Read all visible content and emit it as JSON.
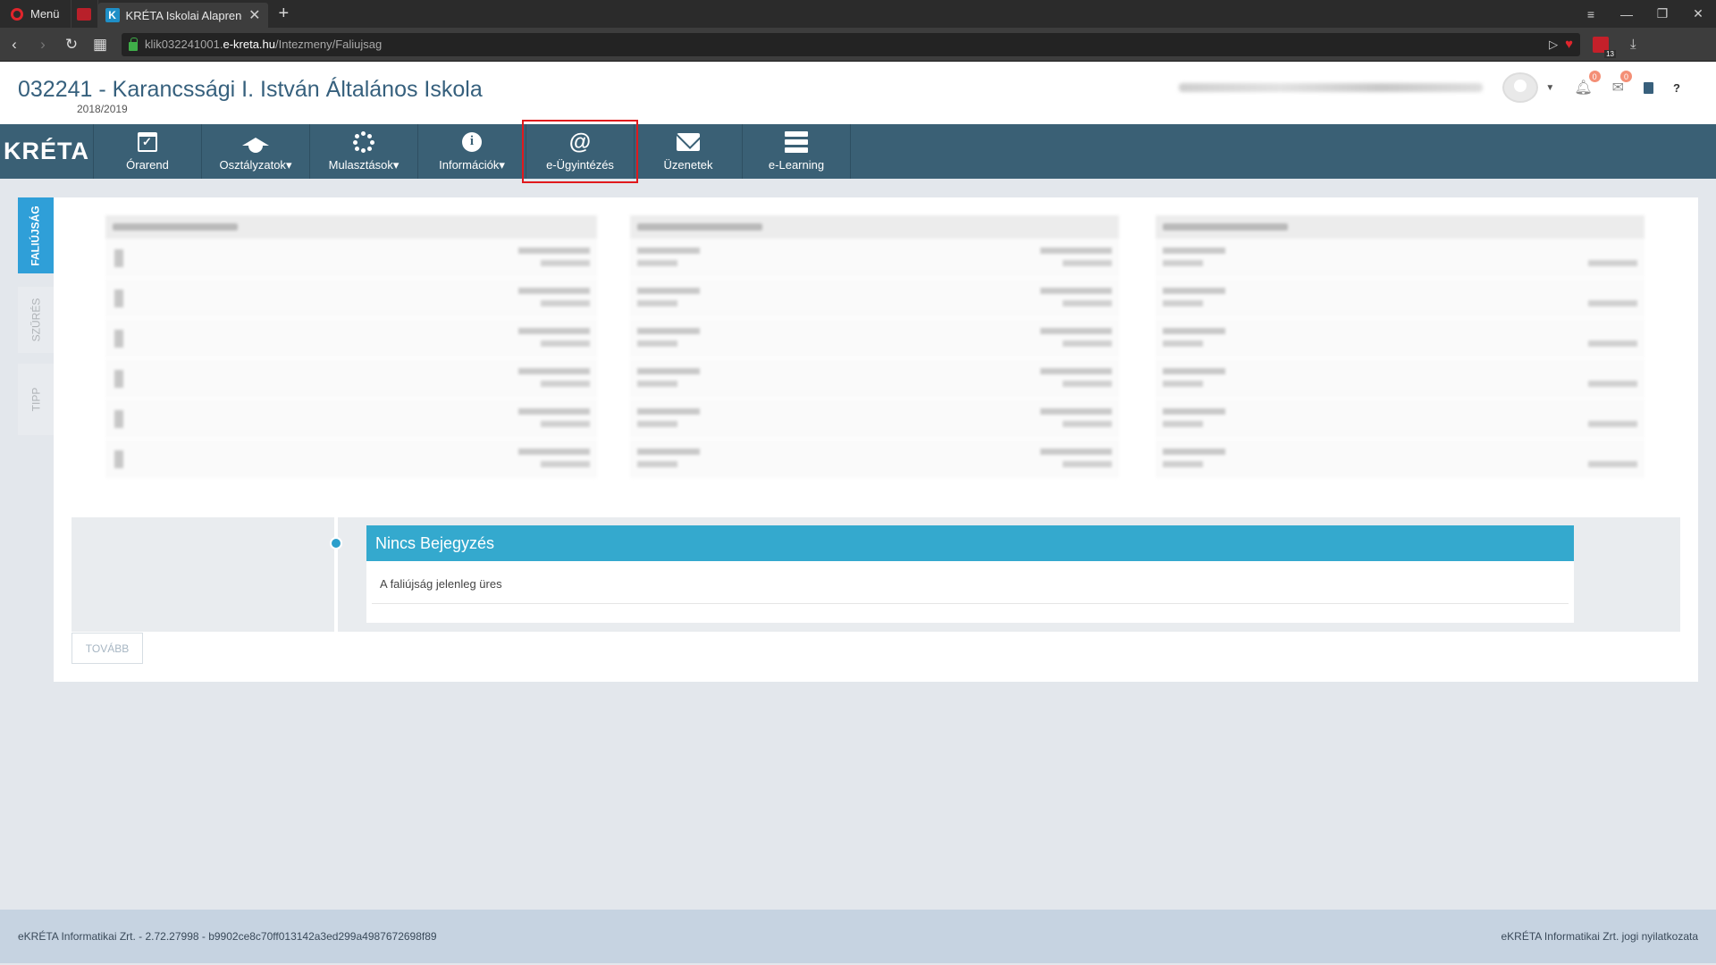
{
  "browser": {
    "menu_label": "Menü",
    "tab_title": "KRÉTA Iskolai Alaprendsze",
    "tab_favicon": "K",
    "new_tab": "+",
    "url_prefix": "klik032241001.",
    "url_domain": "e-kreta.hu",
    "url_path": "/Intezmeny/Faliujsag",
    "extension_badge": "13"
  },
  "header": {
    "school_title": "032241 - Karancssági I. István Általános Iskola",
    "school_year": "2018/2019",
    "notification_count": "0",
    "message_count": "0",
    "help_label": "?"
  },
  "nav": {
    "logo": "KRÉTA",
    "items": [
      {
        "label": "Órarend",
        "icon": "calendar-check-icon"
      },
      {
        "label": "Osztályzatok",
        "icon": "graduation-cap-icon",
        "dropdown": "▾"
      },
      {
        "label": "Mulasztások",
        "icon": "spinner-icon",
        "dropdown": "▾"
      },
      {
        "label": "Információk",
        "icon": "info-icon",
        "dropdown": "▾"
      },
      {
        "label": "e-Ügyintézés",
        "icon": "at-icon",
        "glyph": "@"
      },
      {
        "label": "Üzenetek",
        "icon": "envelope-icon"
      },
      {
        "label": "e-Learning",
        "icon": "server-icon"
      }
    ]
  },
  "side_tabs": [
    {
      "label": "FALIÚJSÁG",
      "active": true
    },
    {
      "label": "SZŰRÉS",
      "active": false
    },
    {
      "label": "TIPP",
      "active": false
    }
  ],
  "wall": {
    "entry_title": "Nincs Bejegyzés",
    "entry_text": "A faliújság jelenleg üres",
    "more_button": "TOVÁBB"
  },
  "footer": {
    "left_text": "eKRÉTA Informatikai Zrt. - 2.72.27998 - b9902ce8c70ff013142a3ed299a4987672698f89",
    "right_text": "eKRÉTA Informatikai Zrt. jogi nyilatkozata"
  },
  "colors": {
    "nav_bg": "#3a6075",
    "accent": "#2f9fd8",
    "highlight": "#e0191d"
  }
}
